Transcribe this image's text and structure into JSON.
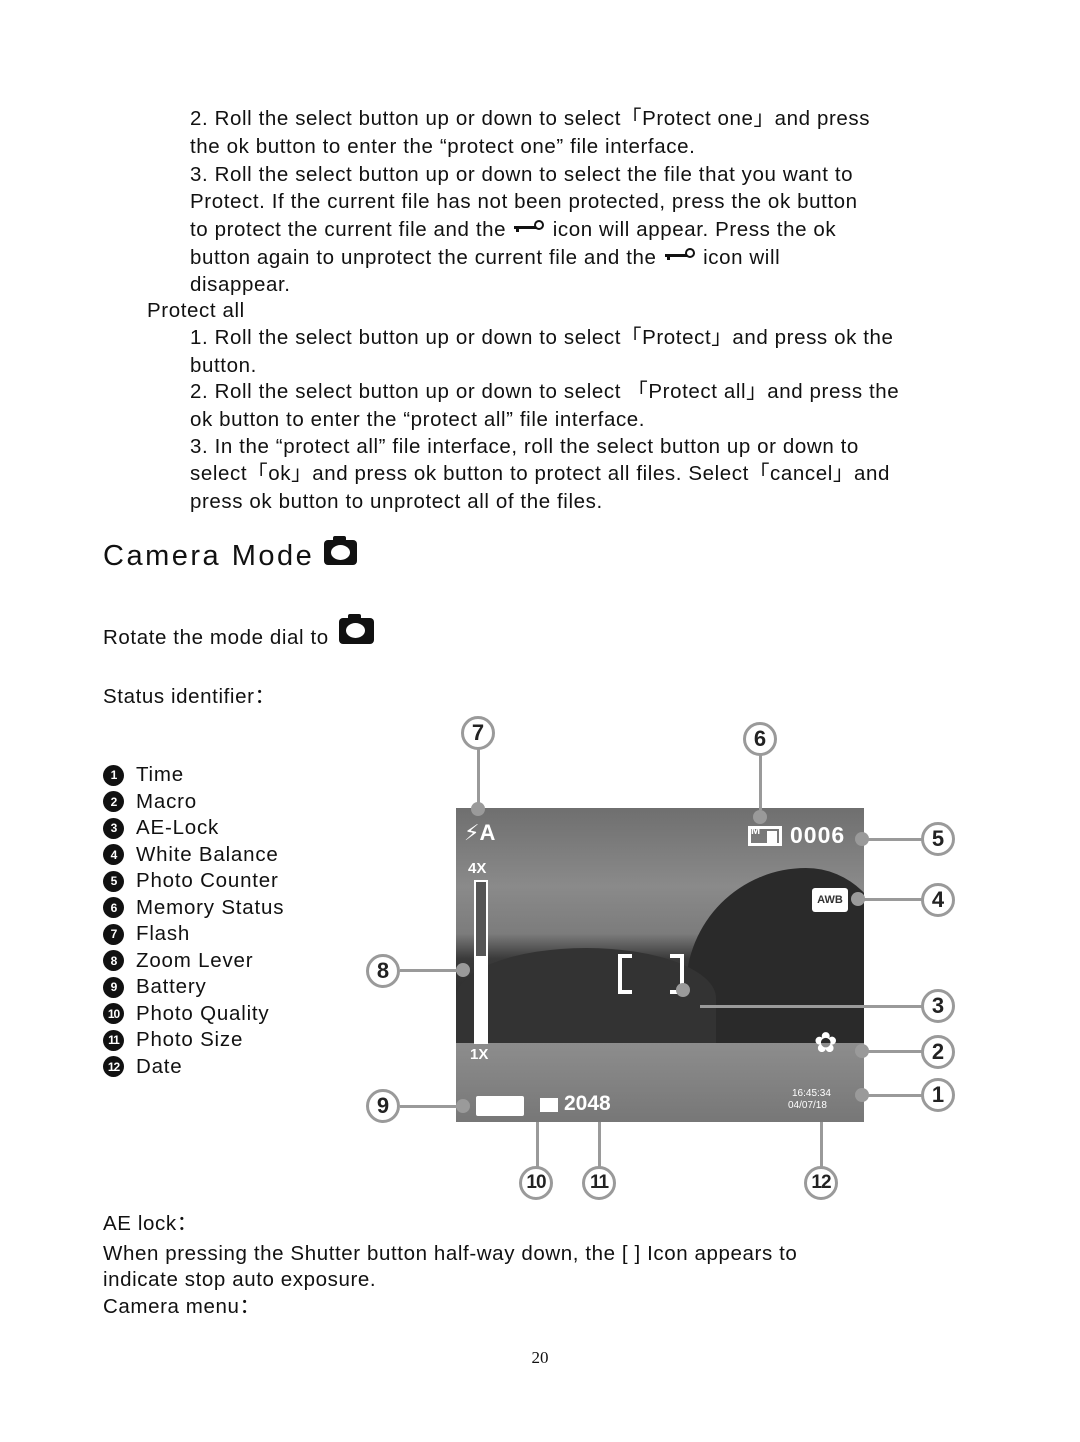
{
  "protect_one_steps": [
    [
      "2. Roll the select button up or down to select「Protect one」and press",
      "the ok button to enter the “protect one” file interface."
    ],
    [
      "3. Roll the select button up or down to select the file that you want to",
      "Protect. If the current file has not been protected, press the ok button"
    ]
  ],
  "protect_one_key_lines": {
    "line1_a": "to protect the current file and the",
    "line1_b": "icon will appear. Press the ok",
    "line2_a": "button again to unprotect the current file and the",
    "line2_b": "icon will",
    "line3": "disappear."
  },
  "protect_all": {
    "heading": "Protect all",
    "lines": [
      "1. Roll the select button up or down to select「Protect」and press ok the",
      "button.",
      "2. Roll the select button up or down to select 「Protect all」and press the",
      "ok button to enter the “protect all” file interface.",
      "3. In the “protect all” file interface, roll the select button up or down to",
      "select「ok」and press ok button to protect all files. Select「cancel」and",
      "press ok button to unprotect all of the files."
    ]
  },
  "camera_mode": {
    "title": "Camera Mode",
    "rotate_text": "Rotate the mode dial to",
    "status_label": "Status identifier："
  },
  "legend": [
    {
      "num": "1",
      "label": "Time"
    },
    {
      "num": "2",
      "label": "Macro"
    },
    {
      "num": "3",
      "label": "AE-Lock"
    },
    {
      "num": "4",
      "label": "White Balance"
    },
    {
      "num": "5",
      "label": "Photo Counter"
    },
    {
      "num": "6",
      "label": "Memory Status"
    },
    {
      "num": "7",
      "label": "Flash"
    },
    {
      "num": "8",
      "label": "Zoom Lever"
    },
    {
      "num": "9",
      "label": "Battery"
    },
    {
      "num": "10",
      "label": "Photo Quality"
    },
    {
      "num": "11",
      "label": "Photo Size"
    },
    {
      "num": "12",
      "label": "Date"
    }
  ],
  "screen": {
    "flash": "⚡A",
    "zoom_max": "4X",
    "zoom_min": "1X",
    "memory": "M",
    "counter": "0006",
    "wb": "AWB",
    "photo_size": "2048",
    "time": "16:45:34",
    "date": "04/07/18"
  },
  "callouts": [
    "1",
    "2",
    "3",
    "4",
    "5",
    "6",
    "7",
    "8",
    "9",
    "10",
    "11",
    "12"
  ],
  "ae_lock": {
    "heading": "AE lock：",
    "line1": "When pressing the Shutter button half-way down, the [    ] Icon appears to",
    "line2": "indicate stop auto exposure."
  },
  "camera_menu": "Camera menu：",
  "page_number": "20"
}
